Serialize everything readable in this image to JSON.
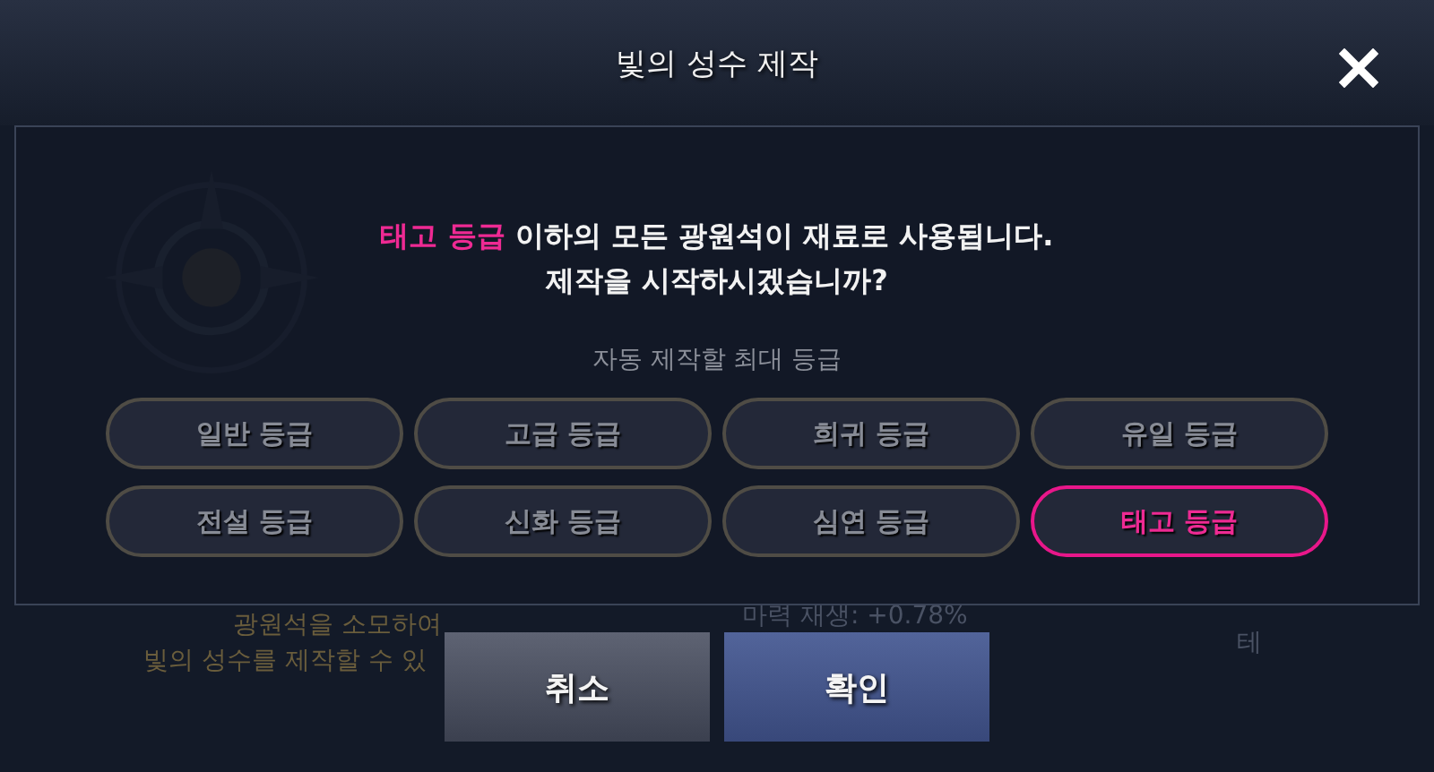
{
  "background": {
    "texts": [
      {
        "kind": "gold",
        "text": "광원석을 소모하여"
      },
      {
        "kind": "gold",
        "text": "빛의 성수를 제작할 수 있"
      },
      {
        "kind": "grey",
        "text": "마력 재생: +0.78%"
      },
      {
        "kind": "grey",
        "text": "테"
      }
    ]
  },
  "dialog": {
    "title": "빛의 성수 제작",
    "message": {
      "highlight": "태고 등급",
      "rest": " 이하의 모든 광원석이 재료로 사용됩니다.",
      "line2": "제작을 시작하시겠습니까?"
    },
    "grade_label": "자동 제작할 최대 등급",
    "grades": [
      {
        "label": "일반 등급",
        "selected": false
      },
      {
        "label": "고급 등급",
        "selected": false
      },
      {
        "label": "희귀 등급",
        "selected": false
      },
      {
        "label": "유일 등급",
        "selected": false
      },
      {
        "label": "전설 등급",
        "selected": false
      },
      {
        "label": "신화 등급",
        "selected": false
      },
      {
        "label": "심연 등급",
        "selected": false
      },
      {
        "label": "태고 등급",
        "selected": true
      }
    ],
    "buttons": [
      {
        "kind": "cancel",
        "label": "취소"
      },
      {
        "kind": "confirm",
        "label": "확인"
      }
    ]
  }
}
